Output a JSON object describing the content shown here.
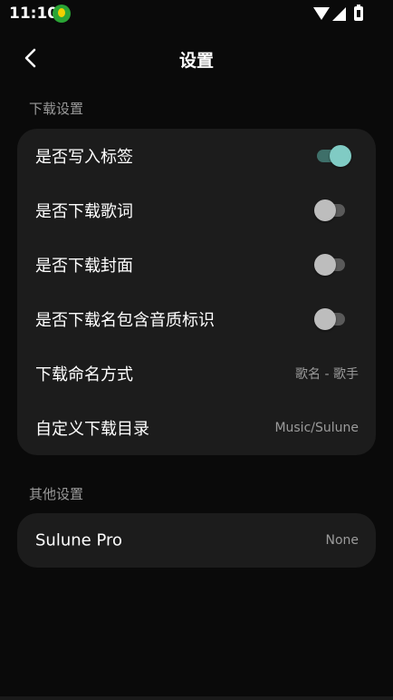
{
  "status_bar": {
    "time": "11:10"
  },
  "header": {
    "title": "设置",
    "back_icon": "chevron-left-icon"
  },
  "download_section": {
    "label": "下载设置",
    "rows": [
      {
        "label": "是否写入标签",
        "type": "switch",
        "on": true
      },
      {
        "label": "是否下载歌词",
        "type": "switch",
        "on": false
      },
      {
        "label": "是否下载封面",
        "type": "switch",
        "on": false
      },
      {
        "label": "是否下载名包含音质标识",
        "type": "switch",
        "on": false
      },
      {
        "label": "下载命名方式",
        "type": "value",
        "value": "歌名 - 歌手"
      },
      {
        "label": "自定义下载目录",
        "type": "value",
        "value": "Music/Sulune"
      }
    ]
  },
  "other_section": {
    "label": "其他设置",
    "rows": [
      {
        "label": "Sulune Pro",
        "type": "value",
        "value": "None"
      }
    ]
  },
  "colors": {
    "background": "#0a0a0a",
    "card": "#1c1c1c",
    "accent": "#80cbc4",
    "switch_off_knob": "#bdbdbd"
  }
}
